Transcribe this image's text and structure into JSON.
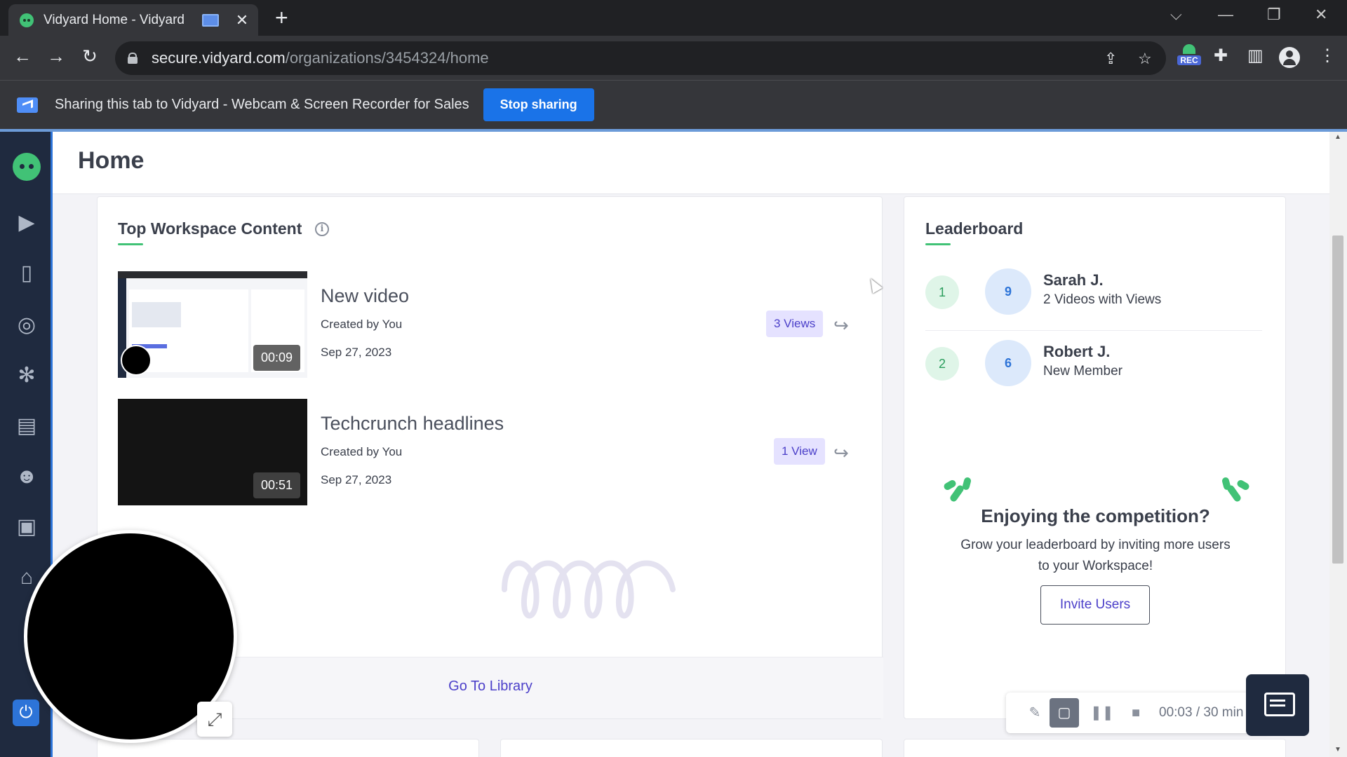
{
  "browser": {
    "tab_title": "Vidyard Home - Vidyard",
    "url_domain": "secure.vidyard.com",
    "url_path": "/organizations/3454324/home",
    "rec_label": "REC"
  },
  "sharing_bar": {
    "message": "Sharing this tab to Vidyard - Webcam & Screen Recorder for Sales",
    "stop_label": "Stop sharing"
  },
  "page": {
    "title": "Home"
  },
  "top_content": {
    "title": "Top Workspace Content",
    "videos": [
      {
        "title": "New video",
        "creator": "Created by You",
        "date": "Sep 27, 2023",
        "duration": "00:09",
        "views": "3 Views"
      },
      {
        "title": "Techcrunch headlines",
        "creator": "Created by You",
        "date": "Sep 27, 2023",
        "duration": "00:51",
        "views": "1 View"
      }
    ],
    "library_link": "Go To Library"
  },
  "leaderboard": {
    "title": "Leaderboard",
    "entries": [
      {
        "rank": "1",
        "score": "9",
        "name": "Sarah J.",
        "detail": "2 Videos with Views"
      },
      {
        "rank": "2",
        "score": "6",
        "name": "Robert J.",
        "detail": "New Member"
      }
    ],
    "promo_title": "Enjoying the competition?",
    "promo_text": "Grow your leaderboard by inviting more users to your Workspace!",
    "invite_label": "Invite Users"
  },
  "recorder": {
    "time": "00:03  /  30 min"
  },
  "colors": {
    "accent": "#4b3fc9",
    "brand_green": "#41c276",
    "nav_bg": "#1f2a3f",
    "chrome_blue": "#1a73e8"
  }
}
